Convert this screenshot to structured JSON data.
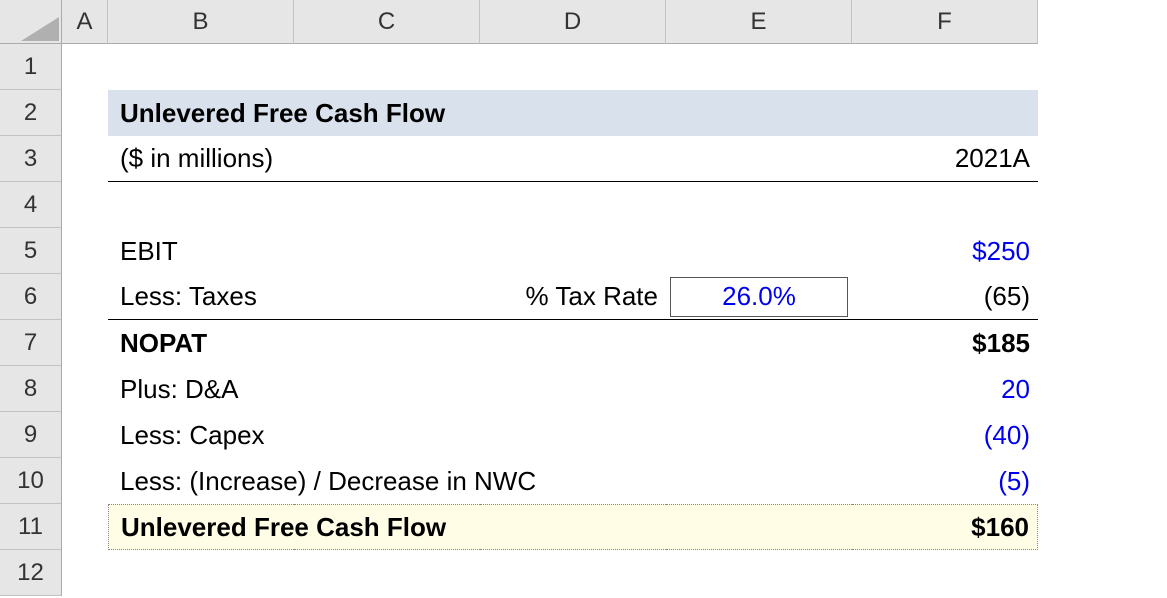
{
  "columns": [
    "A",
    "B",
    "C",
    "D",
    "E",
    "F"
  ],
  "rows": [
    "1",
    "2",
    "3",
    "4",
    "5",
    "6",
    "7",
    "8",
    "9",
    "10",
    "11",
    "12"
  ],
  "title": "Unlevered Free Cash Flow",
  "units": "($ in millions)",
  "period": "2021A",
  "labels": {
    "ebit": "EBIT",
    "less_taxes": "Less: Taxes",
    "tax_rate_label": "% Tax Rate",
    "nopat": "NOPAT",
    "plus_da": "Plus: D&A",
    "less_capex": "Less: Capex",
    "less_nwc": "Less: (Increase) / Decrease in NWC",
    "ufcf": "Unlevered Free Cash Flow"
  },
  "values": {
    "ebit": "$250",
    "tax_rate": "26.0%",
    "taxes": "(65)",
    "nopat": "$185",
    "da": "20",
    "capex": "(40)",
    "nwc": "(5)",
    "ufcf": "$160"
  },
  "chart_data": {
    "type": "table",
    "title": "Unlevered Free Cash Flow",
    "units": "$ in millions",
    "period": "2021A",
    "rows": [
      {
        "label": "EBIT",
        "value": 250
      },
      {
        "label": "Less: Taxes",
        "tax_rate_pct": 26.0,
        "value": -65
      },
      {
        "label": "NOPAT",
        "value": 185,
        "subtotal": true
      },
      {
        "label": "Plus: D&A",
        "value": 20
      },
      {
        "label": "Less: Capex",
        "value": -40
      },
      {
        "label": "Less: (Increase) / Decrease in NWC",
        "value": -5
      },
      {
        "label": "Unlevered Free Cash Flow",
        "value": 160,
        "subtotal": true
      }
    ]
  }
}
